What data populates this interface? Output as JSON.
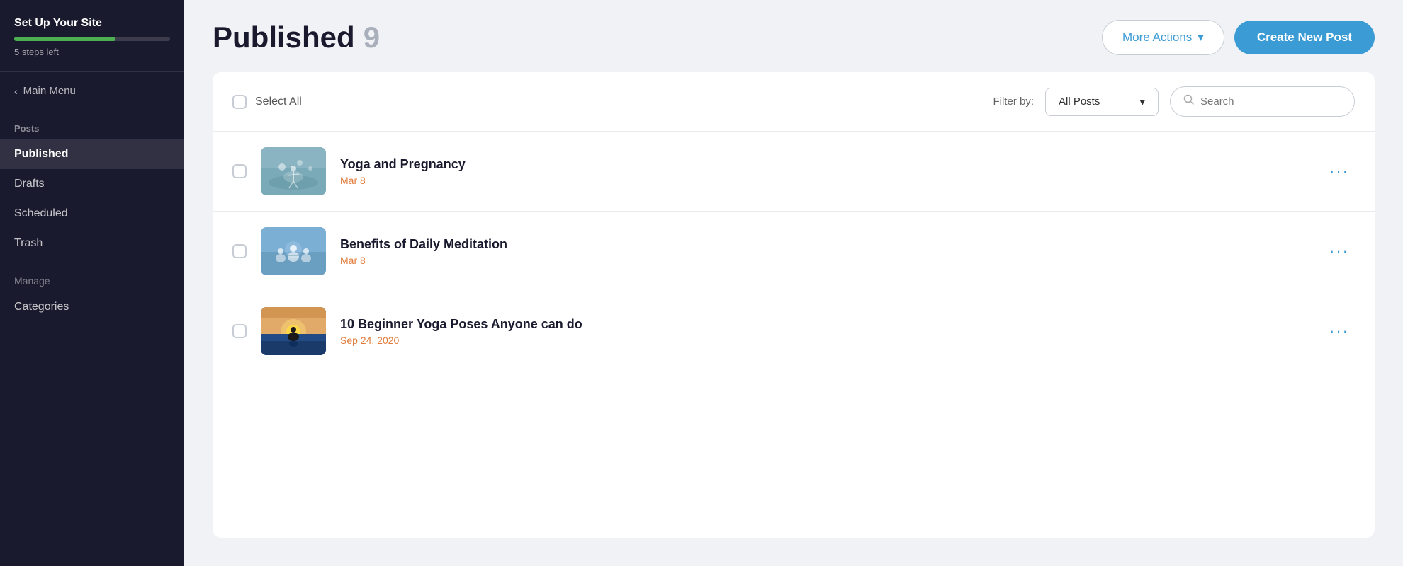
{
  "sidebar": {
    "setup_title": "Set Up Your Site",
    "steps_left": "5 steps left",
    "progress_percent": 65,
    "main_menu_label": "Main Menu",
    "sections": {
      "posts_label": "Posts",
      "posts_items": [
        {
          "id": "published",
          "label": "Published",
          "active": true
        },
        {
          "id": "drafts",
          "label": "Drafts",
          "active": false
        },
        {
          "id": "scheduled",
          "label": "Scheduled",
          "active": false
        },
        {
          "id": "trash",
          "label": "Trash",
          "active": false
        }
      ],
      "manage_label": "Manage",
      "manage_items": [
        {
          "id": "categories",
          "label": "Categories",
          "active": false
        }
      ]
    }
  },
  "header": {
    "title": "Published",
    "count": "9",
    "more_actions_label": "More Actions",
    "create_new_post_label": "Create New Post"
  },
  "toolbar": {
    "select_all_label": "Select All",
    "filter_label": "Filter by:",
    "filter_value": "All Posts",
    "search_placeholder": "Search"
  },
  "posts": [
    {
      "id": "post-1",
      "title": "Yoga and Pregnancy",
      "date": "Mar 8",
      "thumb_type": "yoga"
    },
    {
      "id": "post-2",
      "title": "Benefits of Daily Meditation",
      "date": "Mar 8",
      "thumb_type": "meditation"
    },
    {
      "id": "post-3",
      "title": "10 Beginner Yoga Poses Anyone can do",
      "date": "Sep 24, 2020",
      "thumb_type": "beginner"
    }
  ],
  "icons": {
    "chevron_down": "▾",
    "chevron_left": "‹",
    "more_dots": "···",
    "search": "🔍"
  }
}
